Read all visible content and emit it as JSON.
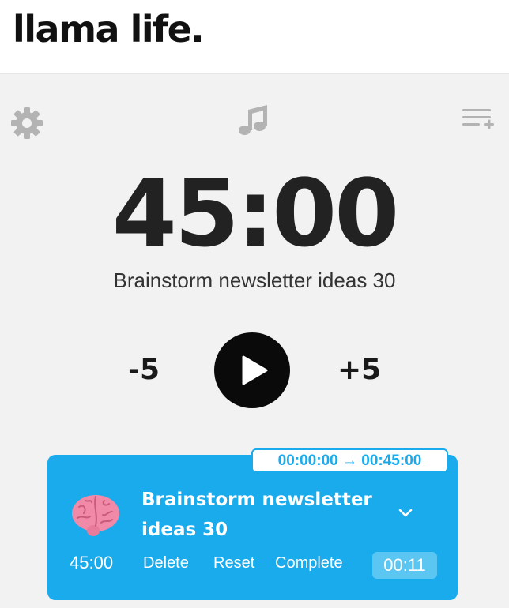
{
  "brand": {
    "logo_text": "llama life."
  },
  "toolbar": {
    "settings_icon": "gear-icon",
    "music_icon": "music-note-icon",
    "add_list_icon": "add-list-icon"
  },
  "timer": {
    "display": "45:00",
    "task_name": "Brainstorm newsletter ideas 30",
    "decrease_label": "-5",
    "increase_label": "+5",
    "play_icon": "play-icon"
  },
  "task_card": {
    "time_range": "00:00:00 → 00:45:00",
    "emoji_icon": "brain-icon",
    "title": "Brainstorm newsletter ideas 30",
    "duration": "45:00",
    "delete_label": "Delete",
    "reset_label": "Reset",
    "complete_label": "Complete",
    "elapsed": "00:11",
    "expand_icon": "chevron-down-icon"
  },
  "colors": {
    "accent": "#1aabed",
    "elapsed_bg": "#5cc6f3",
    "icon_gray": "#b3b3b3",
    "play_bg": "#0a0a0a"
  }
}
